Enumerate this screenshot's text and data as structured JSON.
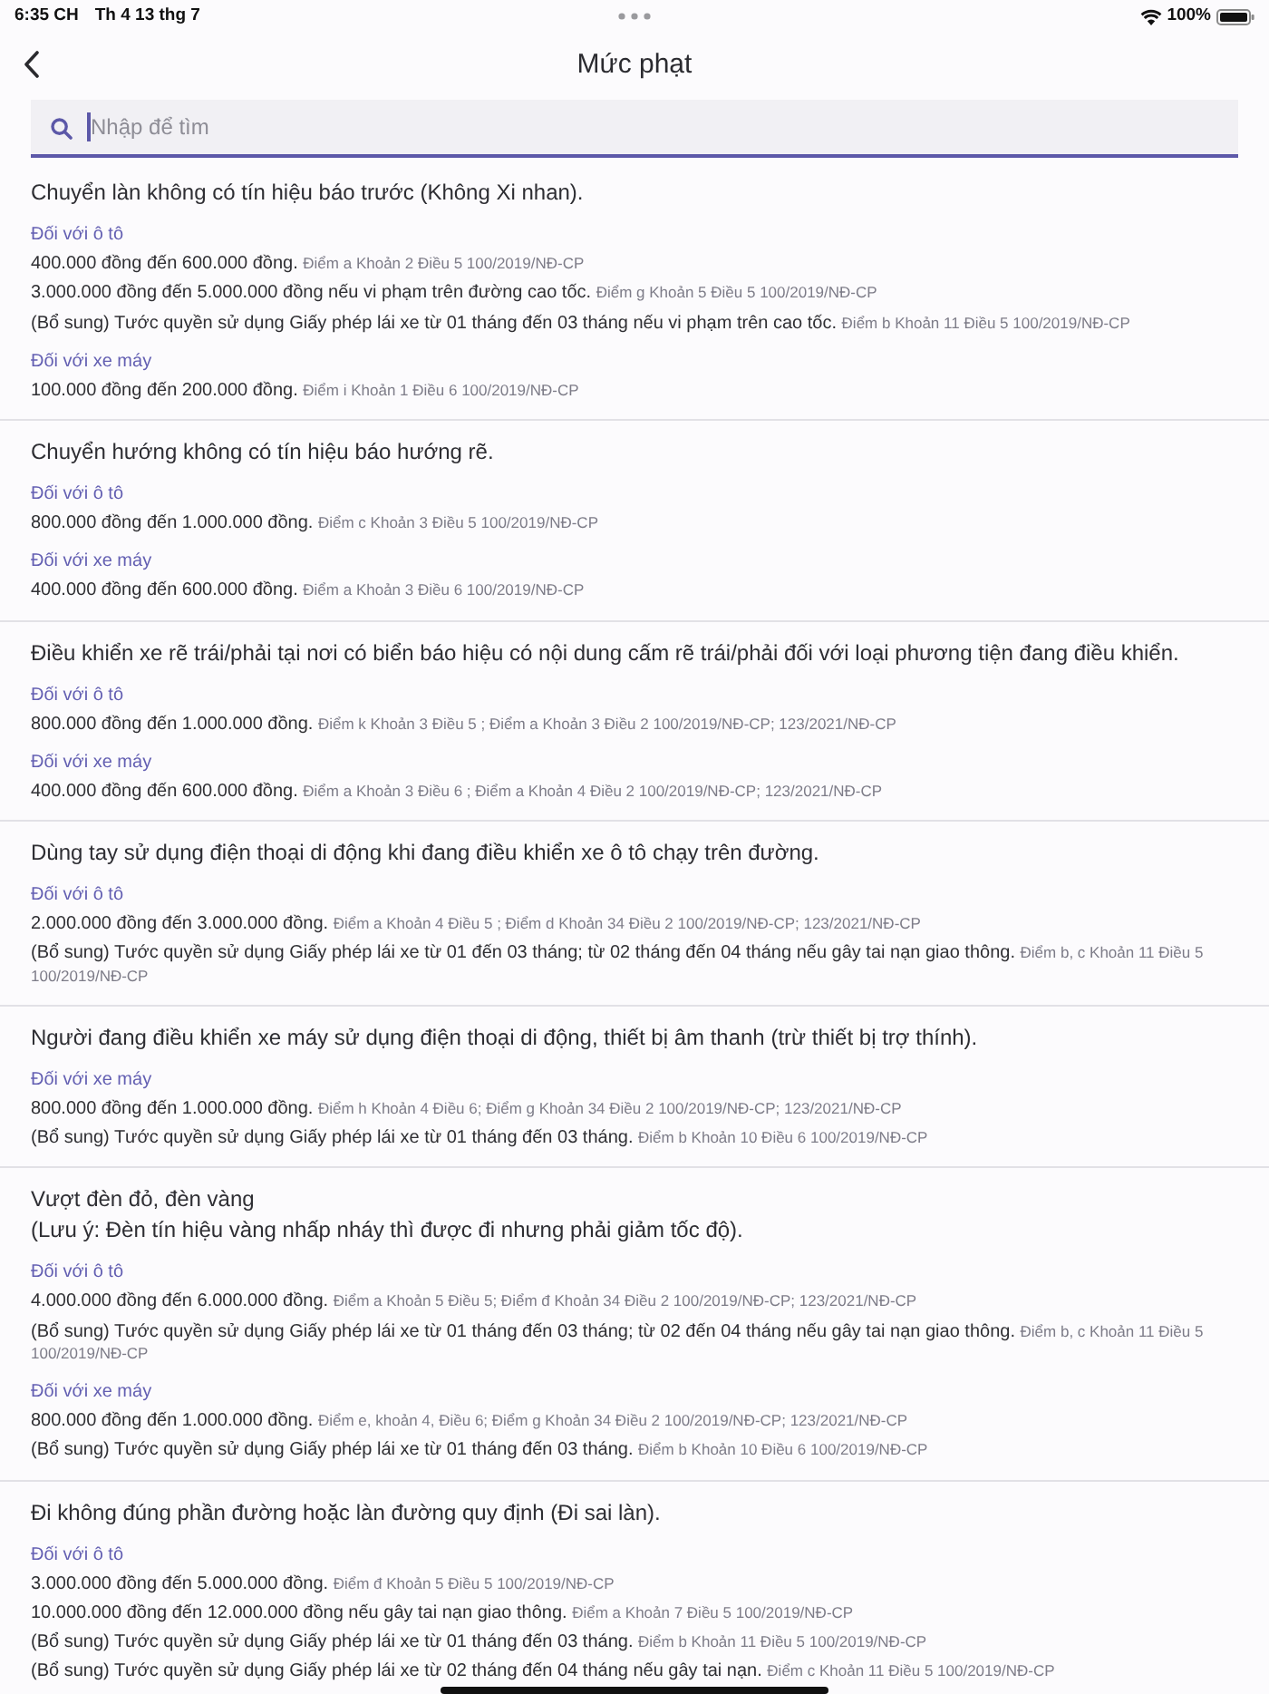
{
  "status_bar": {
    "time": "6:35 CH",
    "date": "Th 4 13 thg 7",
    "battery": "100%"
  },
  "header": {
    "title": "Mức phạt"
  },
  "search": {
    "placeholder": "Nhập để tìm"
  },
  "violations": [
    {
      "title": "Chuyển làn không có tín hiệu báo trước (Không Xi nhan).",
      "groups": [
        {
          "vehicle": "Đối với ô tô",
          "penalties": [
            {
              "text": "400.000 đồng đến 600.000 đồng.",
              "reference": "Điểm a Khoản 2 Điều 5 100/2019/NĐ-CP"
            },
            {
              "text": "3.000.000 đồng đến 5.000.000 đồng nếu vi phạm trên đường cao tốc.",
              "reference": "Điểm g Khoản 5 Điều 5 100/2019/NĐ-CP"
            },
            {
              "text": "(Bổ sung) Tước quyền sử dụng Giấy phép lái xe từ 01 tháng đến 03 tháng nếu vi phạm trên cao tốc.",
              "reference": "Điểm b Khoản 11 Điều 5 100/2019/NĐ-CP"
            }
          ]
        },
        {
          "vehicle": "Đối với xe máy",
          "penalties": [
            {
              "text": "100.000 đồng đến 200.000 đồng.",
              "reference": "Điểm i Khoản 1 Điều 6 100/2019/NĐ-CP"
            }
          ]
        }
      ]
    },
    {
      "title": "Chuyển hướng không có tín hiệu báo hướng rẽ.",
      "groups": [
        {
          "vehicle": "Đối với ô tô",
          "penalties": [
            {
              "text": "800.000 đồng đến 1.000.000 đồng.",
              "reference": "Điểm c Khoản 3 Điều 5 100/2019/NĐ-CP"
            }
          ]
        },
        {
          "vehicle": "Đối với xe máy",
          "penalties": [
            {
              "text": "400.000 đồng đến 600.000 đồng.",
              "reference": "Điểm a Khoản 3 Điều 6 100/2019/NĐ-CP"
            }
          ]
        }
      ]
    },
    {
      "title": "Điều khiển xe rẽ trái/phải tại nơi có biển báo hiệu có nội dung cấm rẽ trái/phải đối với loại phương tiện đang điều khiển.",
      "groups": [
        {
          "vehicle": "Đối với ô tô",
          "penalties": [
            {
              "text": "800.000 đồng đến 1.000.000 đồng.",
              "reference": "Điểm k Khoản 3 Điều 5 ; Điểm a Khoản 3 Điều 2 100/2019/NĐ-CP; 123/2021/NĐ-CP"
            }
          ]
        },
        {
          "vehicle": "Đối với xe máy",
          "penalties": [
            {
              "text": "400.000 đồng đến 600.000 đồng.",
              "reference": "Điểm a Khoản 3 Điều 6 ; Điểm a Khoản 4 Điều 2 100/2019/NĐ-CP; 123/2021/NĐ-CP"
            }
          ]
        }
      ]
    },
    {
      "title": "Dùng tay sử dụng điện thoại di động khi đang điều khiển xe ô tô chạy trên đường.",
      "groups": [
        {
          "vehicle": "Đối với ô tô",
          "penalties": [
            {
              "text": "2.000.000 đồng đến 3.000.000 đồng.",
              "reference": "Điểm a Khoản 4 Điều 5 ; Điểm d Khoản 34 Điều 2 100/2019/NĐ-CP; 123/2021/NĐ-CP"
            },
            {
              "text": "(Bổ sung) Tước quyền sử dụng Giấy phép lái xe từ 01 đến 03 tháng; từ 02 tháng đến 04 tháng nếu gây tai nạn giao thông.",
              "reference": "Điểm b, c Khoản 11 Điều 5 100/2019/NĐ-CP"
            }
          ]
        }
      ]
    },
    {
      "title": "Người đang điều khiển xe máy sử dụng điện thoại di động, thiết bị âm thanh (trừ thiết bị trợ thính).",
      "groups": [
        {
          "vehicle": "Đối với xe máy",
          "penalties": [
            {
              "text": "800.000 đồng đến 1.000.000 đồng.",
              "reference": "Điểm h Khoản 4 Điều 6; Điểm g Khoản 34 Điều 2 100/2019/NĐ-CP; 123/2021/NĐ-CP"
            },
            {
              "text": "(Bổ sung) Tước quyền sử dụng Giấy phép lái xe từ 01 tháng đến 03 tháng.",
              "reference": "Điểm b Khoản 10 Điều 6 100/2019/NĐ-CP"
            }
          ]
        }
      ]
    },
    {
      "title": "Vượt đèn đỏ, đèn vàng\n(Lưu ý: Đèn tín hiệu vàng nhấp nháy thì được đi nhưng phải giảm tốc độ).",
      "groups": [
        {
          "vehicle": "Đối với ô tô",
          "penalties": [
            {
              "text": "4.000.000 đồng đến 6.000.000 đồng.",
              "reference": "Điểm a Khoản 5 Điều 5; Điểm đ Khoản 34 Điều 2 100/2019/NĐ-CP; 123/2021/NĐ-CP"
            },
            {
              "text": "(Bổ sung) Tước quyền sử dụng Giấy phép lái xe từ 01 tháng đến 03 tháng; từ 02 đến 04 tháng nếu gây tai nạn giao thông.",
              "reference": "Điểm b, c Khoản 11 Điều 5 100/2019/NĐ-CP"
            }
          ]
        },
        {
          "vehicle": "Đối với xe máy",
          "penalties": [
            {
              "text": "800.000 đồng đến 1.000.000 đồng.",
              "reference": "Điểm e, khoản 4, Điều 6; Điểm g Khoản 34 Điều 2 100/2019/NĐ-CP; 123/2021/NĐ-CP"
            },
            {
              "text": "(Bổ sung) Tước quyền sử dụng Giấy phép lái xe từ 01 tháng đến 03 tháng.",
              "reference": "Điểm b Khoản 10 Điều 6 100/2019/NĐ-CP"
            }
          ]
        }
      ]
    },
    {
      "title": "Đi không đúng phần đường hoặc làn đường quy định (Đi sai làn).",
      "groups": [
        {
          "vehicle": "Đối với ô tô",
          "penalties": [
            {
              "text": "3.000.000 đồng đến 5.000.000 đồng.",
              "reference": "Điểm đ Khoản 5 Điều 5 100/2019/NĐ-CP"
            },
            {
              "text": "10.000.000 đồng đến 12.000.000 đồng nếu gây tai nạn giao thông.",
              "reference": "Điểm a Khoản 7 Điều 5 100/2019/NĐ-CP"
            },
            {
              "text": "(Bổ sung) Tước quyền sử dụng Giấy phép lái xe từ 01 tháng đến 03 tháng.",
              "reference": "Điểm b Khoản 11 Điều 5 100/2019/NĐ-CP"
            },
            {
              "text": "(Bổ sung) Tước quyền sử dụng Giấy phép lái xe từ 02 tháng đến 04 tháng nếu gây tai nạn.",
              "reference": "Điểm c Khoản 11 Điều 5 100/2019/NĐ-CP"
            }
          ]
        }
      ]
    }
  ]
}
